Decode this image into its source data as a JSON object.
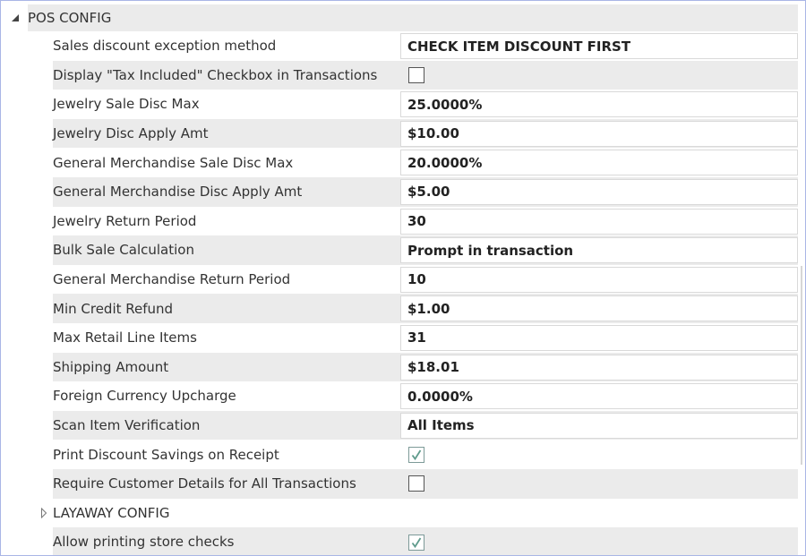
{
  "pos_config": {
    "title": "POS CONFIG",
    "rows": [
      {
        "label": "Sales discount exception method",
        "type": "text",
        "value": "CHECK ITEM DISCOUNT FIRST"
      },
      {
        "label": "Display \"Tax Included\" Checkbox in Transactions",
        "type": "checkbox",
        "checked": false
      },
      {
        "label": "Jewelry Sale Disc Max",
        "type": "text",
        "value": "25.0000%"
      },
      {
        "label": "Jewelry Disc Apply Amt",
        "type": "text",
        "value": "$10.00"
      },
      {
        "label": "General Merchandise Sale Disc Max",
        "type": "text",
        "value": "20.0000%"
      },
      {
        "label": "General Merchandise Disc Apply Amt",
        "type": "text",
        "value": "$5.00"
      },
      {
        "label": "Jewelry Return Period",
        "type": "text",
        "value": "30"
      },
      {
        "label": "Bulk Sale Calculation",
        "type": "text",
        "value": "Prompt in transaction"
      },
      {
        "label": "General Merchandise Return Period",
        "type": "text",
        "value": "10"
      },
      {
        "label": "Min Credit Refund",
        "type": "text",
        "value": "$1.00"
      },
      {
        "label": "Max Retail Line Items",
        "type": "text",
        "value": "31"
      },
      {
        "label": "Shipping Amount",
        "type": "text",
        "value": "$18.01"
      },
      {
        "label": "Foreign Currency Upcharge",
        "type": "text",
        "value": "0.0000%"
      },
      {
        "label": "Scan Item Verification",
        "type": "text",
        "value": "All Items"
      },
      {
        "label": "Print Discount Savings on Receipt",
        "type": "checkbox",
        "checked": true
      },
      {
        "label": "Require Customer Details for All Transactions",
        "type": "checkbox",
        "checked": false
      }
    ]
  },
  "layaway_config": {
    "title": "LAYAWAY CONFIG",
    "expanded": false
  },
  "extra_rows": [
    {
      "label": "Allow printing store checks",
      "type": "checkbox",
      "checked": true
    }
  ],
  "icons": {
    "expanded": "expanded-triangle-icon",
    "collapsed": "collapsed-triangle-icon",
    "check": "checkmark-icon"
  },
  "colors": {
    "row_shade": "#ebebeb",
    "border": "#a9b6e6",
    "checkmark": "#5f9b8c"
  }
}
